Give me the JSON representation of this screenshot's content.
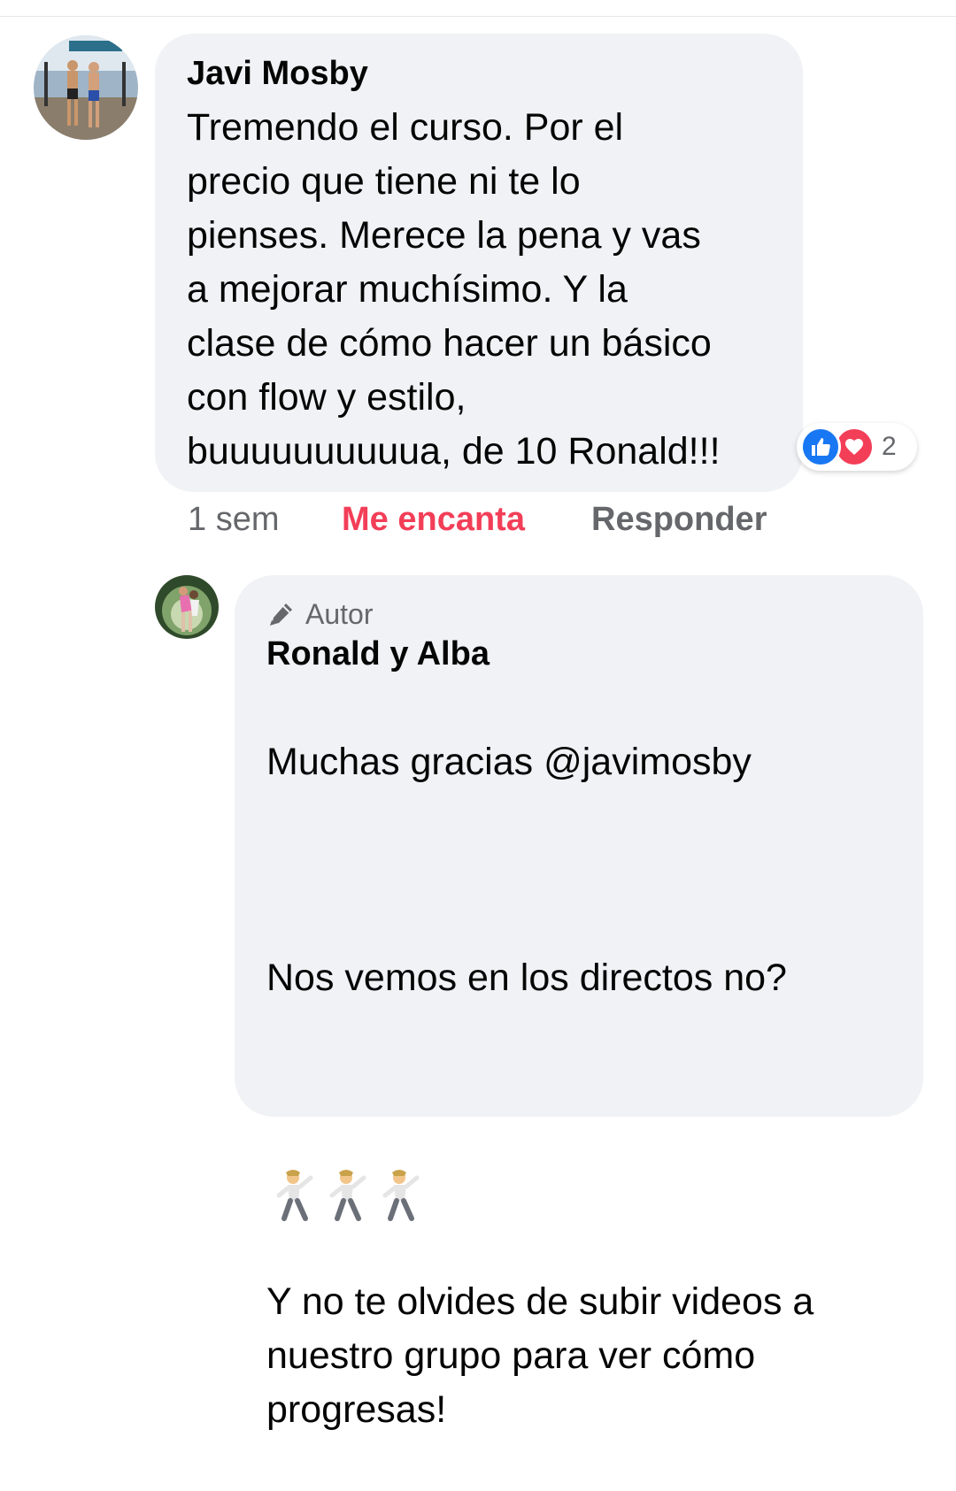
{
  "comment": {
    "author": "Javi Mosby",
    "text": "Tremendo el curso. Por el\nprecio que tiene ni te lo\npienses. Merece la pena y vas\na mejorar muchísimo. Y la\nclase de cómo hacer un básico\ncon flow y estilo,\nbuuuuuuuuuua, de 10 Ronald!!!",
    "reactions": {
      "icons": [
        "like-icon",
        "love-icon"
      ],
      "count": "2"
    },
    "time": "1 sem",
    "reaction_label": "Me encanta",
    "reply_label": "Responder",
    "colors": {
      "love": "#f33e58",
      "like": "#1877f2",
      "meta": "#65676b",
      "bubble": "#f0f2f5"
    }
  },
  "reply": {
    "badge": "Autor",
    "badge_icon": "pencil-icon",
    "author": "Ronald y Alba",
    "line1": "Muchas gracias @javimosby",
    "line2": "Nos vemos en los directos no?",
    "emoji": "🕺🕺🕺",
    "line3": "Y no te olvides de subir videos a\nnuestro grupo para ver cómo\nprogresas!"
  }
}
